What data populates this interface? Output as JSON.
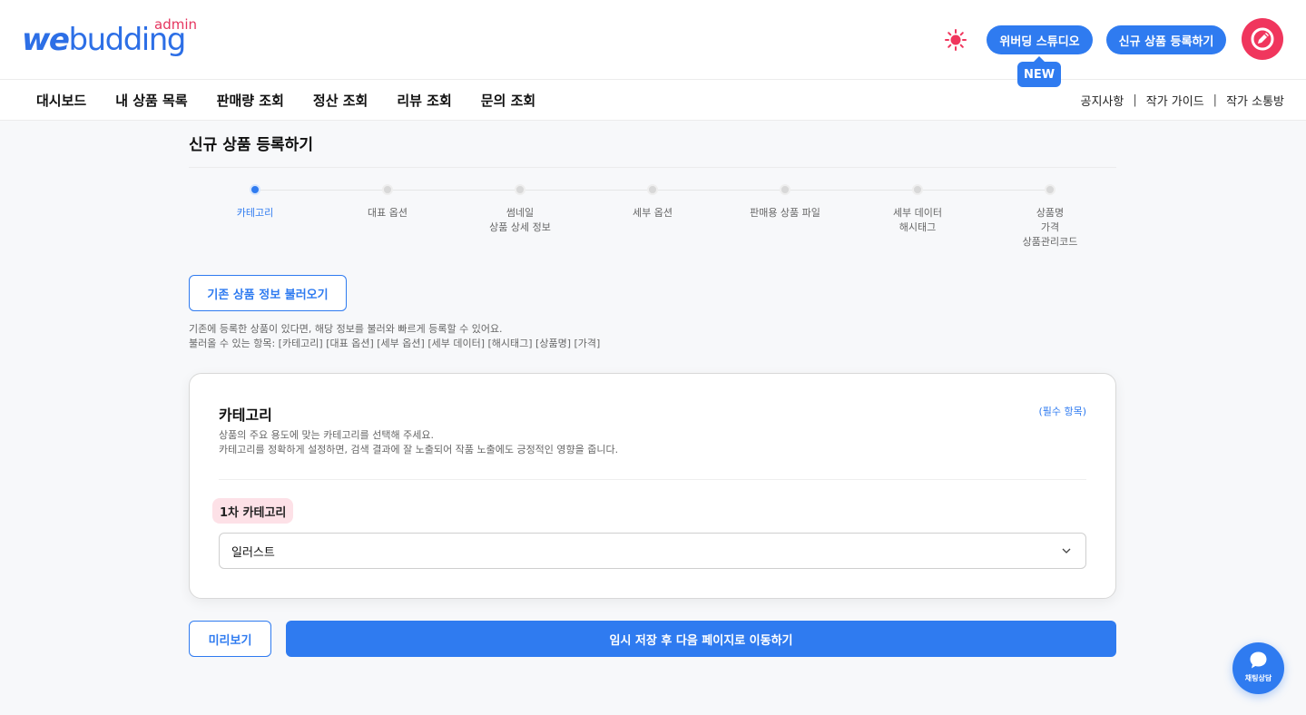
{
  "brand": {
    "logo_main_we": "we",
    "logo_main_rest": "budding",
    "logo_sub": "admin"
  },
  "header": {
    "studio_label": "위버딩 스튜디오",
    "new_badge": "NEW",
    "register_label": "신규 상품 등록하기"
  },
  "nav": {
    "items": [
      "대시보드",
      "내 상품 목록",
      "판매량 조회",
      "정산 조회",
      "리뷰 조회",
      "문의 조회"
    ],
    "right": [
      "공지사항",
      "작가 가이드",
      "작가 소통방"
    ],
    "separator": "|"
  },
  "page": {
    "title": "신규 상품 등록하기"
  },
  "steps": [
    {
      "label": "카테고리",
      "active": true
    },
    {
      "label": "대표 옵션",
      "active": false
    },
    {
      "label": "썸네일\n상품 상세 정보",
      "active": false
    },
    {
      "label": "세부 옵션",
      "active": false
    },
    {
      "label": "판매용 상품 파일",
      "active": false
    },
    {
      "label": "세부 데이터\n해시태그",
      "active": false
    },
    {
      "label": "상품명\n가격\n상품관리코드",
      "active": false
    }
  ],
  "load": {
    "button": "기존 상품 정보 불러오기",
    "help_line1": "기존에 등록한 상품이 있다면, 해당 정보를 불러와 빠르게 등록할 수 있어요.",
    "help_line2": "불러올 수 있는 항목: [카테고리] [대표 옵션] [세부 옵션] [세부 데이터] [해시태그] [상품명] [가격]"
  },
  "category_card": {
    "title": "카테고리",
    "required": "(필수 항목)",
    "desc_line1": "상품의 주요 용도에 맞는 카테고리를 선택해 주세요.",
    "desc_line2": "카테고리를 정확하게 설정하면, 검색 결과에 잘 노출되어 작품 노출에도 긍정적인 영향을 줍니다.",
    "primary_label": "1차 카테고리",
    "selected": "일러스트"
  },
  "actions": {
    "preview": "미리보기",
    "next": "임시 저장 후 다음 페이지로 이동하기"
  },
  "chat": {
    "label": "채팅상담"
  },
  "colors": {
    "accent": "#2f7bf0",
    "brand_pink": "#f0365d",
    "tag_bg": "#fde1e7"
  }
}
